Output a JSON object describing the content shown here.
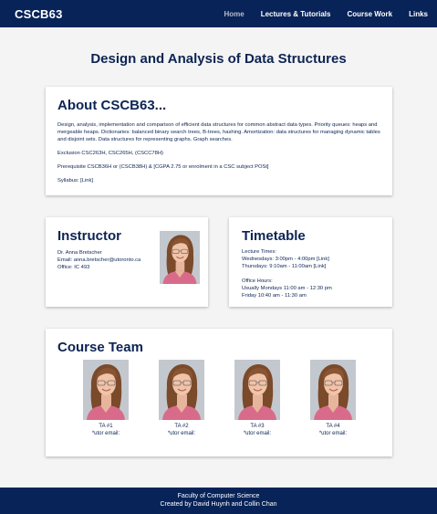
{
  "navbar": {
    "brand": "CSCB63",
    "links": [
      "Home",
      "Lectures & Tutorials",
      "Course Work",
      "Links"
    ]
  },
  "page_title": "Design and Analysis of Data Structures",
  "about": {
    "heading": "About CSCB63...",
    "description": "Design, analysis, implementation and comparison of efficient data structures for common abstract data types. Priority queues: heaps and mergeable heaps. Dictionaries: balanced binary search trees, B-trees, hashing. Amortization: data structures for managing dynamic tables and disjoint sets. Data structures for representing graphs. Graph searches.",
    "exclusion": "Exclusion CSC263H, CSC265H, (CSCC78H)",
    "prerequisite": "Prerequisite CSCB36H or (CSCB38H) & [CGPA 2.75 or enrolment in a CSC subject POSt]",
    "syllabus": "Syllabus: [Link]"
  },
  "instructor": {
    "heading": "Instructor",
    "name": "Dr. Anna Bretscher",
    "email": "Email: anna.bretscher@utoronto.ca",
    "office": "Office: IC 493"
  },
  "timetable": {
    "heading": "Timetable",
    "lecture_label": "Lecture Times:",
    "lecture_1": "Wednesdays: 3:00pm - 4:00pm [Link]",
    "lecture_2": "Thursdays: 9:10am - 11:00am [Link]",
    "office_label": "Office Hours:",
    "office_1": "Usually Mondays 11:00 am - 12:30 pm",
    "office_2": "Friday 10:40 am - 11:30 am"
  },
  "team": {
    "heading": "Course Team",
    "members": [
      {
        "name": "TA #1",
        "email": "*utor email:"
      },
      {
        "name": "TA #2",
        "email": "*utor email:"
      },
      {
        "name": "TA #3",
        "email": "*utor email:"
      },
      {
        "name": "TA #4",
        "email": "*utor email:"
      }
    ]
  },
  "footer": {
    "line1": "Faculty of Computer Science",
    "line2": "Created by David Huynh and Collin Chan"
  },
  "colors": {
    "navy": "#072358",
    "heading_text": "#0c2453",
    "background": "#f4f4f4",
    "card": "#ffffff"
  }
}
